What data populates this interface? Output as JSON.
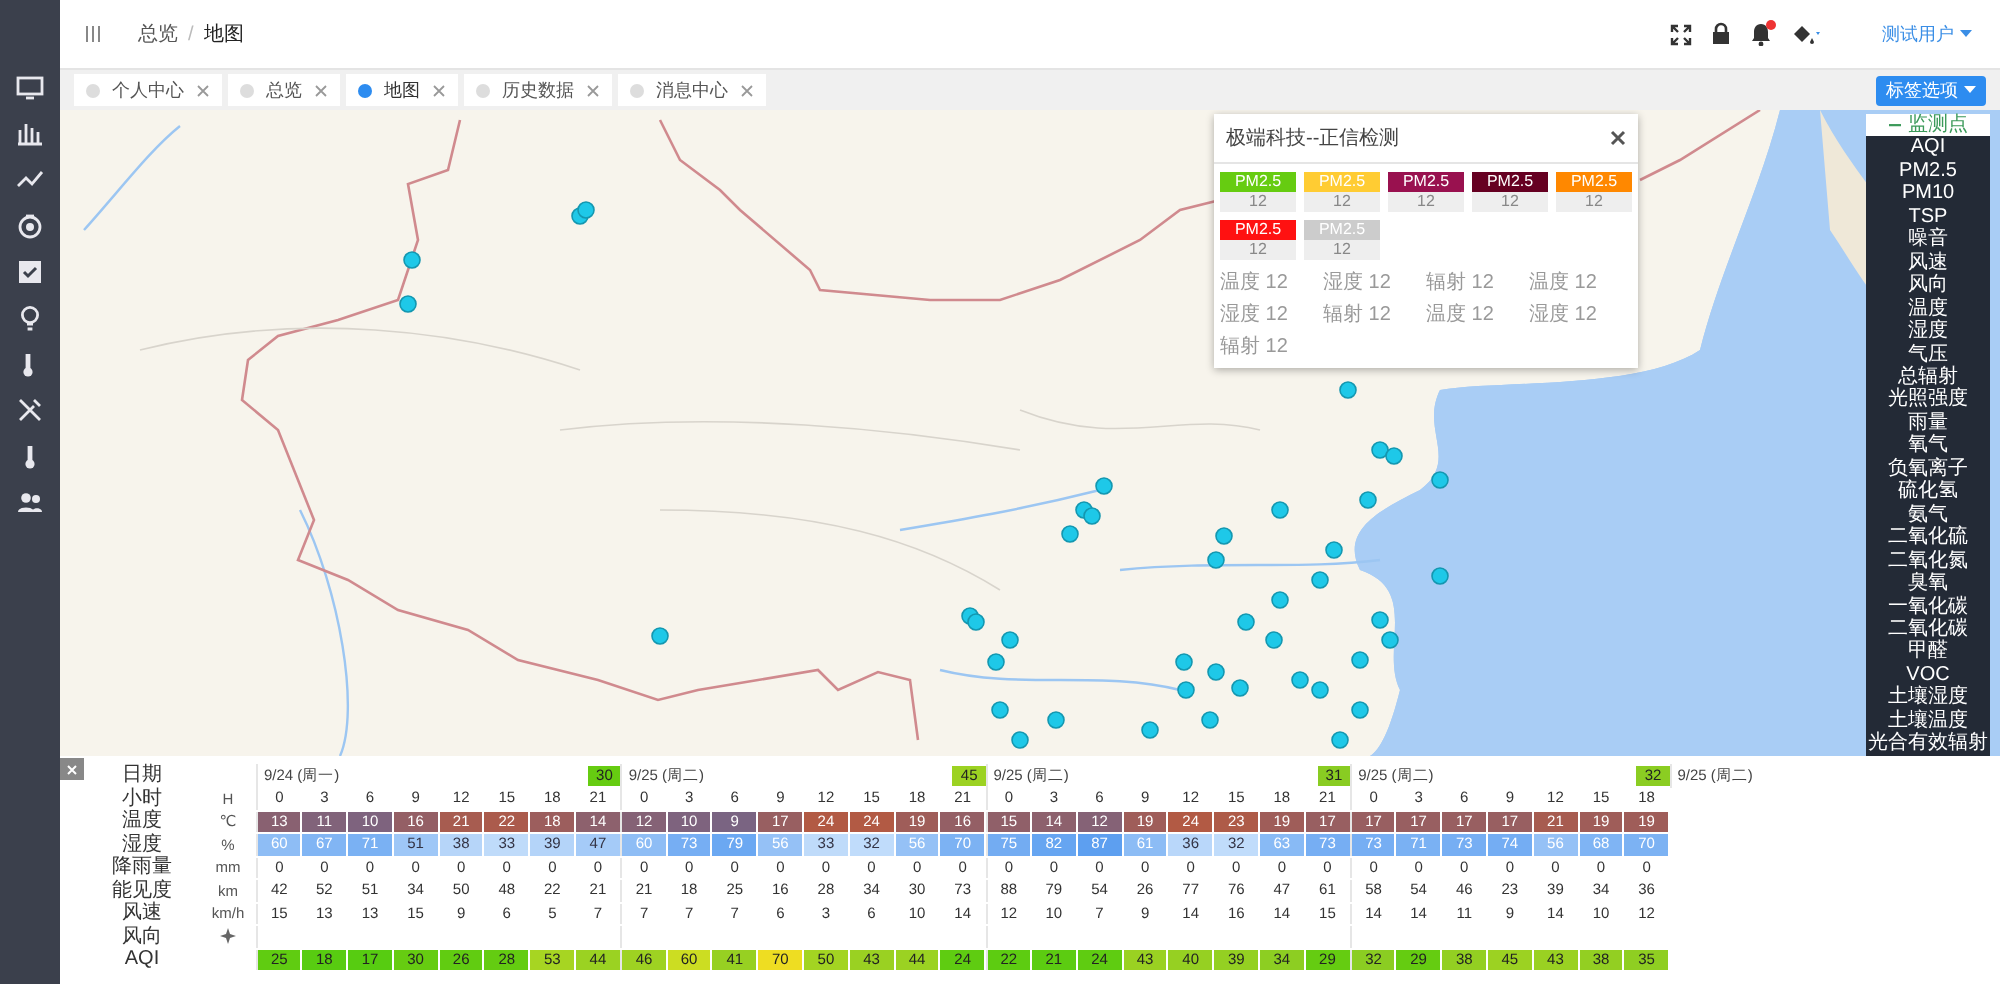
{
  "topbar": {
    "breadcrumb": [
      "总览",
      "地图"
    ],
    "separator": "/",
    "has_notifications": true,
    "user": "测试用户"
  },
  "tabs": [
    {
      "label": "个人中心",
      "selected": false
    },
    {
      "label": "总览",
      "selected": false
    },
    {
      "label": "地图",
      "selected": true
    },
    {
      "label": "历史数据",
      "selected": false
    },
    {
      "label": "消息中心",
      "selected": false
    }
  ],
  "tab_options_button": "标签选项",
  "popup": {
    "title": "极端科技--正信检测",
    "cards": [
      {
        "label": "PM2.5",
        "value": "12",
        "color": "#66cc11"
      },
      {
        "label": "PM2.5",
        "value": "12",
        "color": "#ffcc33"
      },
      {
        "label": "PM2.5",
        "value": "12",
        "color": "#99114f"
      },
      {
        "label": "PM2.5",
        "value": "12",
        "color": "#660022"
      },
      {
        "label": "PM2.5",
        "value": "12",
        "color": "#ff8800"
      },
      {
        "label": "PM2.5",
        "value": "12",
        "color": "#ff1111"
      },
      {
        "label": "PM2.5",
        "value": "12",
        "color": "#cccccc"
      }
    ],
    "readings": [
      "温度 12",
      "湿度 12",
      "辐射 12",
      "温度 12",
      "湿度 12",
      "辐射 12",
      "温度 12",
      "湿度 12",
      "辐射 12"
    ]
  },
  "legend_panel": {
    "title": "监测点",
    "expanded": true,
    "items": [
      "AQI",
      "PM2.5",
      "PM10",
      "TSP",
      "噪音",
      "风速",
      "风向",
      "温度",
      "湿度",
      "气压",
      "总辐射",
      "光照强度",
      "雨量",
      "氧气",
      "负氧离子",
      "硫化氢",
      "氨气",
      "二氧化硫",
      "二氧化氮",
      "臭氧",
      "一氧化碳",
      "二氧化碳",
      "甲醛",
      "VOC",
      "土壤湿度",
      "土壤温度",
      "光合有效辐射"
    ]
  },
  "forecast": {
    "rows": [
      {
        "kind": "date",
        "label": "日期"
      },
      {
        "kind": "hour",
        "label": "小时",
        "unit": "H"
      },
      {
        "kind": "temp",
        "label": "温度",
        "unit": "℃"
      },
      {
        "kind": "humidity",
        "label": "湿度",
        "unit": "%"
      },
      {
        "kind": "rain",
        "label": "降雨量",
        "unit": "mm"
      },
      {
        "kind": "visibility",
        "label": "能见度",
        "unit": "km"
      },
      {
        "kind": "wind",
        "label": "风速",
        "unit": "km/h"
      },
      {
        "kind": "direction",
        "label": "风向"
      },
      {
        "kind": "aqi",
        "label": "AQI"
      }
    ],
    "days": [
      {
        "date": "9/24 (周一)",
        "aqi": "30",
        "hours": [
          {
            "hour": "0",
            "temp": "13",
            "humidity": "60",
            "rain": "0",
            "visibility": "42",
            "wind": "15",
            "aqi": "25"
          },
          {
            "hour": "3",
            "temp": "11",
            "humidity": "67",
            "rain": "0",
            "visibility": "52",
            "wind": "13",
            "aqi": "18"
          },
          {
            "hour": "6",
            "temp": "10",
            "humidity": "71",
            "rain": "0",
            "visibility": "51",
            "wind": "13",
            "aqi": "17"
          },
          {
            "hour": "9",
            "temp": "16",
            "humidity": "51",
            "rain": "0",
            "visibility": "34",
            "wind": "15",
            "aqi": "30"
          },
          {
            "hour": "12",
            "temp": "21",
            "humidity": "38",
            "rain": "0",
            "visibility": "50",
            "wind": "9",
            "aqi": "26"
          },
          {
            "hour": "15",
            "temp": "22",
            "humidity": "33",
            "rain": "0",
            "visibility": "48",
            "wind": "6",
            "aqi": "28"
          },
          {
            "hour": "18",
            "temp": "18",
            "humidity": "39",
            "rain": "0",
            "visibility": "22",
            "wind": "5",
            "aqi": "53"
          },
          {
            "hour": "21",
            "temp": "14",
            "humidity": "47",
            "rain": "0",
            "visibility": "21",
            "wind": "7",
            "aqi": "44"
          }
        ]
      },
      {
        "date": "9/25 (周二)",
        "aqi": "45",
        "hours": [
          {
            "hour": "0",
            "temp": "12",
            "humidity": "60",
            "rain": "0",
            "visibility": "21",
            "wind": "7",
            "aqi": "46"
          },
          {
            "hour": "3",
            "temp": "10",
            "humidity": "73",
            "rain": "0",
            "visibility": "18",
            "wind": "7",
            "aqi": "60"
          },
          {
            "hour": "6",
            "temp": "9",
            "humidity": "79",
            "rain": "0",
            "visibility": "25",
            "wind": "7",
            "aqi": "41"
          },
          {
            "hour": "9",
            "temp": "17",
            "humidity": "56",
            "rain": "0",
            "visibility": "16",
            "wind": "6",
            "aqi": "70"
          },
          {
            "hour": "12",
            "temp": "24",
            "humidity": "33",
            "rain": "0",
            "visibility": "28",
            "wind": "3",
            "aqi": "50"
          },
          {
            "hour": "15",
            "temp": "24",
            "humidity": "32",
            "rain": "0",
            "visibility": "34",
            "wind": "6",
            "aqi": "43"
          },
          {
            "hour": "18",
            "temp": "19",
            "humidity": "56",
            "rain": "0",
            "visibility": "30",
            "wind": "10",
            "aqi": "44"
          },
          {
            "hour": "21",
            "temp": "16",
            "humidity": "70",
            "rain": "0",
            "visibility": "73",
            "wind": "14",
            "aqi": "24"
          }
        ]
      },
      {
        "date": "9/25 (周二)",
        "aqi": "31",
        "hours": [
          {
            "hour": "0",
            "temp": "15",
            "humidity": "75",
            "rain": "0",
            "visibility": "88",
            "wind": "12",
            "aqi": "22"
          },
          {
            "hour": "3",
            "temp": "14",
            "humidity": "82",
            "rain": "0",
            "visibility": "79",
            "wind": "10",
            "aqi": "21"
          },
          {
            "hour": "6",
            "temp": "12",
            "humidity": "87",
            "rain": "0",
            "visibility": "54",
            "wind": "7",
            "aqi": "24"
          },
          {
            "hour": "9",
            "temp": "19",
            "humidity": "61",
            "rain": "0",
            "visibility": "26",
            "wind": "9",
            "aqi": "43"
          },
          {
            "hour": "12",
            "temp": "24",
            "humidity": "36",
            "rain": "0",
            "visibility": "77",
            "wind": "14",
            "aqi": "40"
          },
          {
            "hour": "15",
            "temp": "23",
            "humidity": "32",
            "rain": "0",
            "visibility": "76",
            "wind": "16",
            "aqi": "39"
          },
          {
            "hour": "18",
            "temp": "19",
            "humidity": "63",
            "rain": "0",
            "visibility": "47",
            "wind": "14",
            "aqi": "34"
          },
          {
            "hour": "21",
            "temp": "17",
            "humidity": "73",
            "rain": "0",
            "visibility": "61",
            "wind": "15",
            "aqi": "29"
          }
        ]
      },
      {
        "date": "9/25 (周二)",
        "aqi": "32",
        "hours": [
          {
            "hour": "0",
            "temp": "17",
            "humidity": "73",
            "rain": "0",
            "visibility": "58",
            "wind": "14",
            "aqi": "32"
          },
          {
            "hour": "3",
            "temp": "17",
            "humidity": "71",
            "rain": "0",
            "visibility": "54",
            "wind": "14",
            "aqi": "29"
          },
          {
            "hour": "6",
            "temp": "17",
            "humidity": "73",
            "rain": "0",
            "visibility": "46",
            "wind": "11",
            "aqi": "38"
          },
          {
            "hour": "9",
            "temp": "17",
            "humidity": "74",
            "rain": "0",
            "visibility": "23",
            "wind": "9",
            "aqi": "45"
          },
          {
            "hour": "12",
            "temp": "21",
            "humidity": "56",
            "rain": "0",
            "visibility": "39",
            "wind": "14",
            "aqi": "43"
          },
          {
            "hour": "15",
            "temp": "19",
            "humidity": "68",
            "rain": "0",
            "visibility": "34",
            "wind": "10",
            "aqi": "38"
          },
          {
            "hour": "18",
            "temp": "19",
            "humidity": "70",
            "rain": "0",
            "visibility": "36",
            "wind": "12",
            "aqi": "35"
          }
        ]
      },
      {
        "date": "9/25 (周二)"
      }
    ]
  }
}
